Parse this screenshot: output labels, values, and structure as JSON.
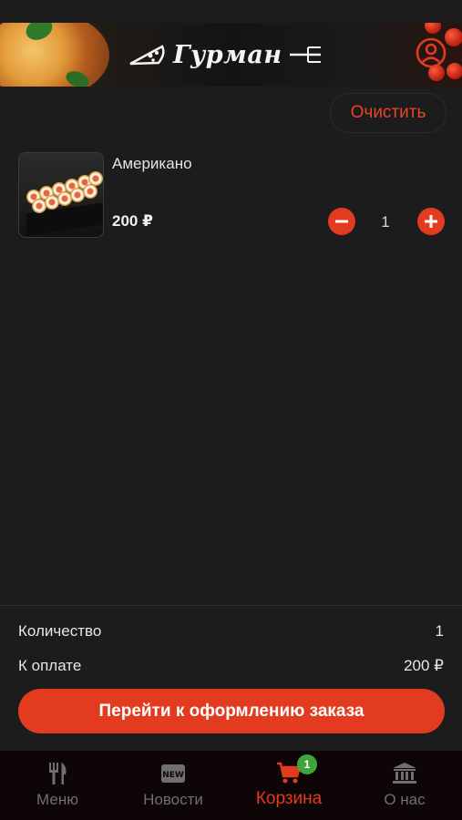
{
  "header": {
    "logo_text": "Гурман",
    "profile_icon": "user-circle-icon"
  },
  "cart": {
    "clear_label": "Очистить",
    "items": [
      {
        "name": "Американо",
        "price": "200 ₽",
        "quantity": "1"
      }
    ]
  },
  "summary": {
    "quantity_label": "Количество",
    "quantity_value": "1",
    "total_label": "К оплате",
    "total_value": "200 ₽"
  },
  "checkout": {
    "label": "Перейти к оформлению заказа"
  },
  "tabbar": {
    "tabs": [
      {
        "label": "Меню",
        "icon": "fork-knife-icon"
      },
      {
        "label": "Новости",
        "icon": "new-badge-icon"
      },
      {
        "label": "Корзина",
        "icon": "cart-icon",
        "badge": "1",
        "active": true
      },
      {
        "label": "О нас",
        "icon": "bank-icon"
      }
    ]
  },
  "colors": {
    "accent": "#e23b1f",
    "background": "#1c1c1c",
    "badge": "#3ea53d"
  }
}
